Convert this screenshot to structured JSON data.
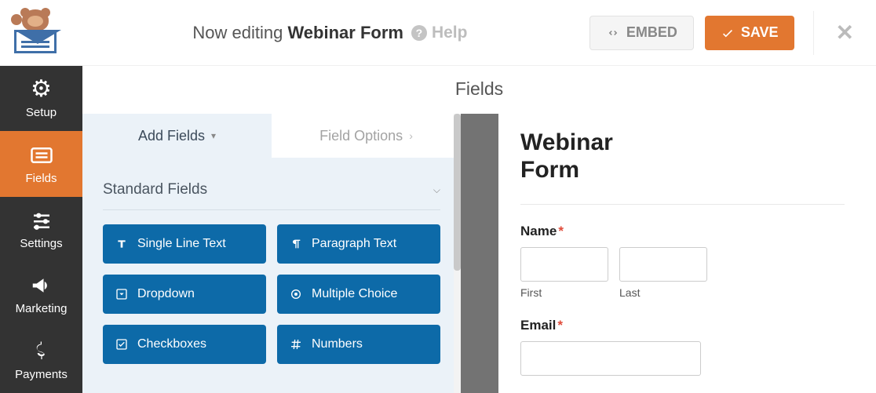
{
  "header": {
    "editing_prefix": "Now editing",
    "form_name": "Webinar Form",
    "help_label": "Help",
    "embed_label": "EMBED",
    "save_label": "SAVE"
  },
  "sidebar": {
    "items": [
      {
        "label": "Setup"
      },
      {
        "label": "Fields"
      },
      {
        "label": "Settings"
      },
      {
        "label": "Marketing"
      },
      {
        "label": "Payments"
      }
    ]
  },
  "panel": {
    "title": "Fields",
    "tabs": {
      "add": "Add Fields",
      "options": "Field Options"
    },
    "section_title": "Standard Fields",
    "fields": [
      "Single Line Text",
      "Paragraph Text",
      "Dropdown",
      "Multiple Choice",
      "Checkboxes",
      "Numbers"
    ]
  },
  "preview": {
    "form_title": "Webinar Form",
    "name_label": "Name",
    "first_label": "First",
    "last_label": "Last",
    "email_label": "Email",
    "required_marker": "*"
  }
}
